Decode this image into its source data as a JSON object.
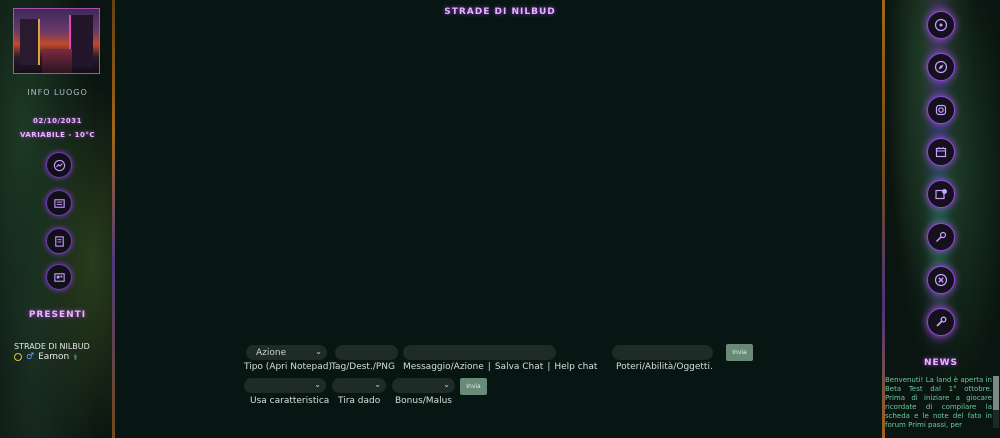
{
  "header": {
    "title": "STRADE DI NILBUD"
  },
  "left_sidebar": {
    "info_label": "INFO LUOGO",
    "date": "02/10/2031",
    "weather": "VARIABILE - 10°C",
    "icons": [
      "messenger-icon",
      "newspaper-icon",
      "document-icon",
      "gallery-icon"
    ],
    "presenti_title": "PRESENTI",
    "presenti_location": "STRADE DI NILBUD",
    "presenti_users": [
      {
        "name": "Eamon",
        "gender_symbol": "♂"
      }
    ]
  },
  "right_sidebar": {
    "icons": [
      "disc-icon",
      "compass-icon",
      "instagram-icon",
      "calendar-icon",
      "settings-calendar-icon",
      "pin-icon",
      "close-icon",
      "wrench-icon"
    ],
    "news_title": "NEWS",
    "news_text": "Benvenuti! La land è aperta in Beta Test dal 1° ottobre. Prima di iniziare a giocare ricordate di compilare la scheda e le note del fato in forum Primi passi, per"
  },
  "chat_form": {
    "type_select_value": "Azione",
    "type_label": "Tipo (Apri Notepad)",
    "tag_label": "Tag/Dest./PNG",
    "message_label": "Messaggio/Azione",
    "save_chat": "Salva Chat",
    "help_chat": "Help chat",
    "separator": "|",
    "powers_label": "Poteri/Abilità/Oggetti.",
    "send_label": "Invia",
    "use_char_label": "Usa caratteristica",
    "dice_label": "Tira dado",
    "bonus_label": "Bonus/Malus",
    "send2_label": "Invia"
  }
}
